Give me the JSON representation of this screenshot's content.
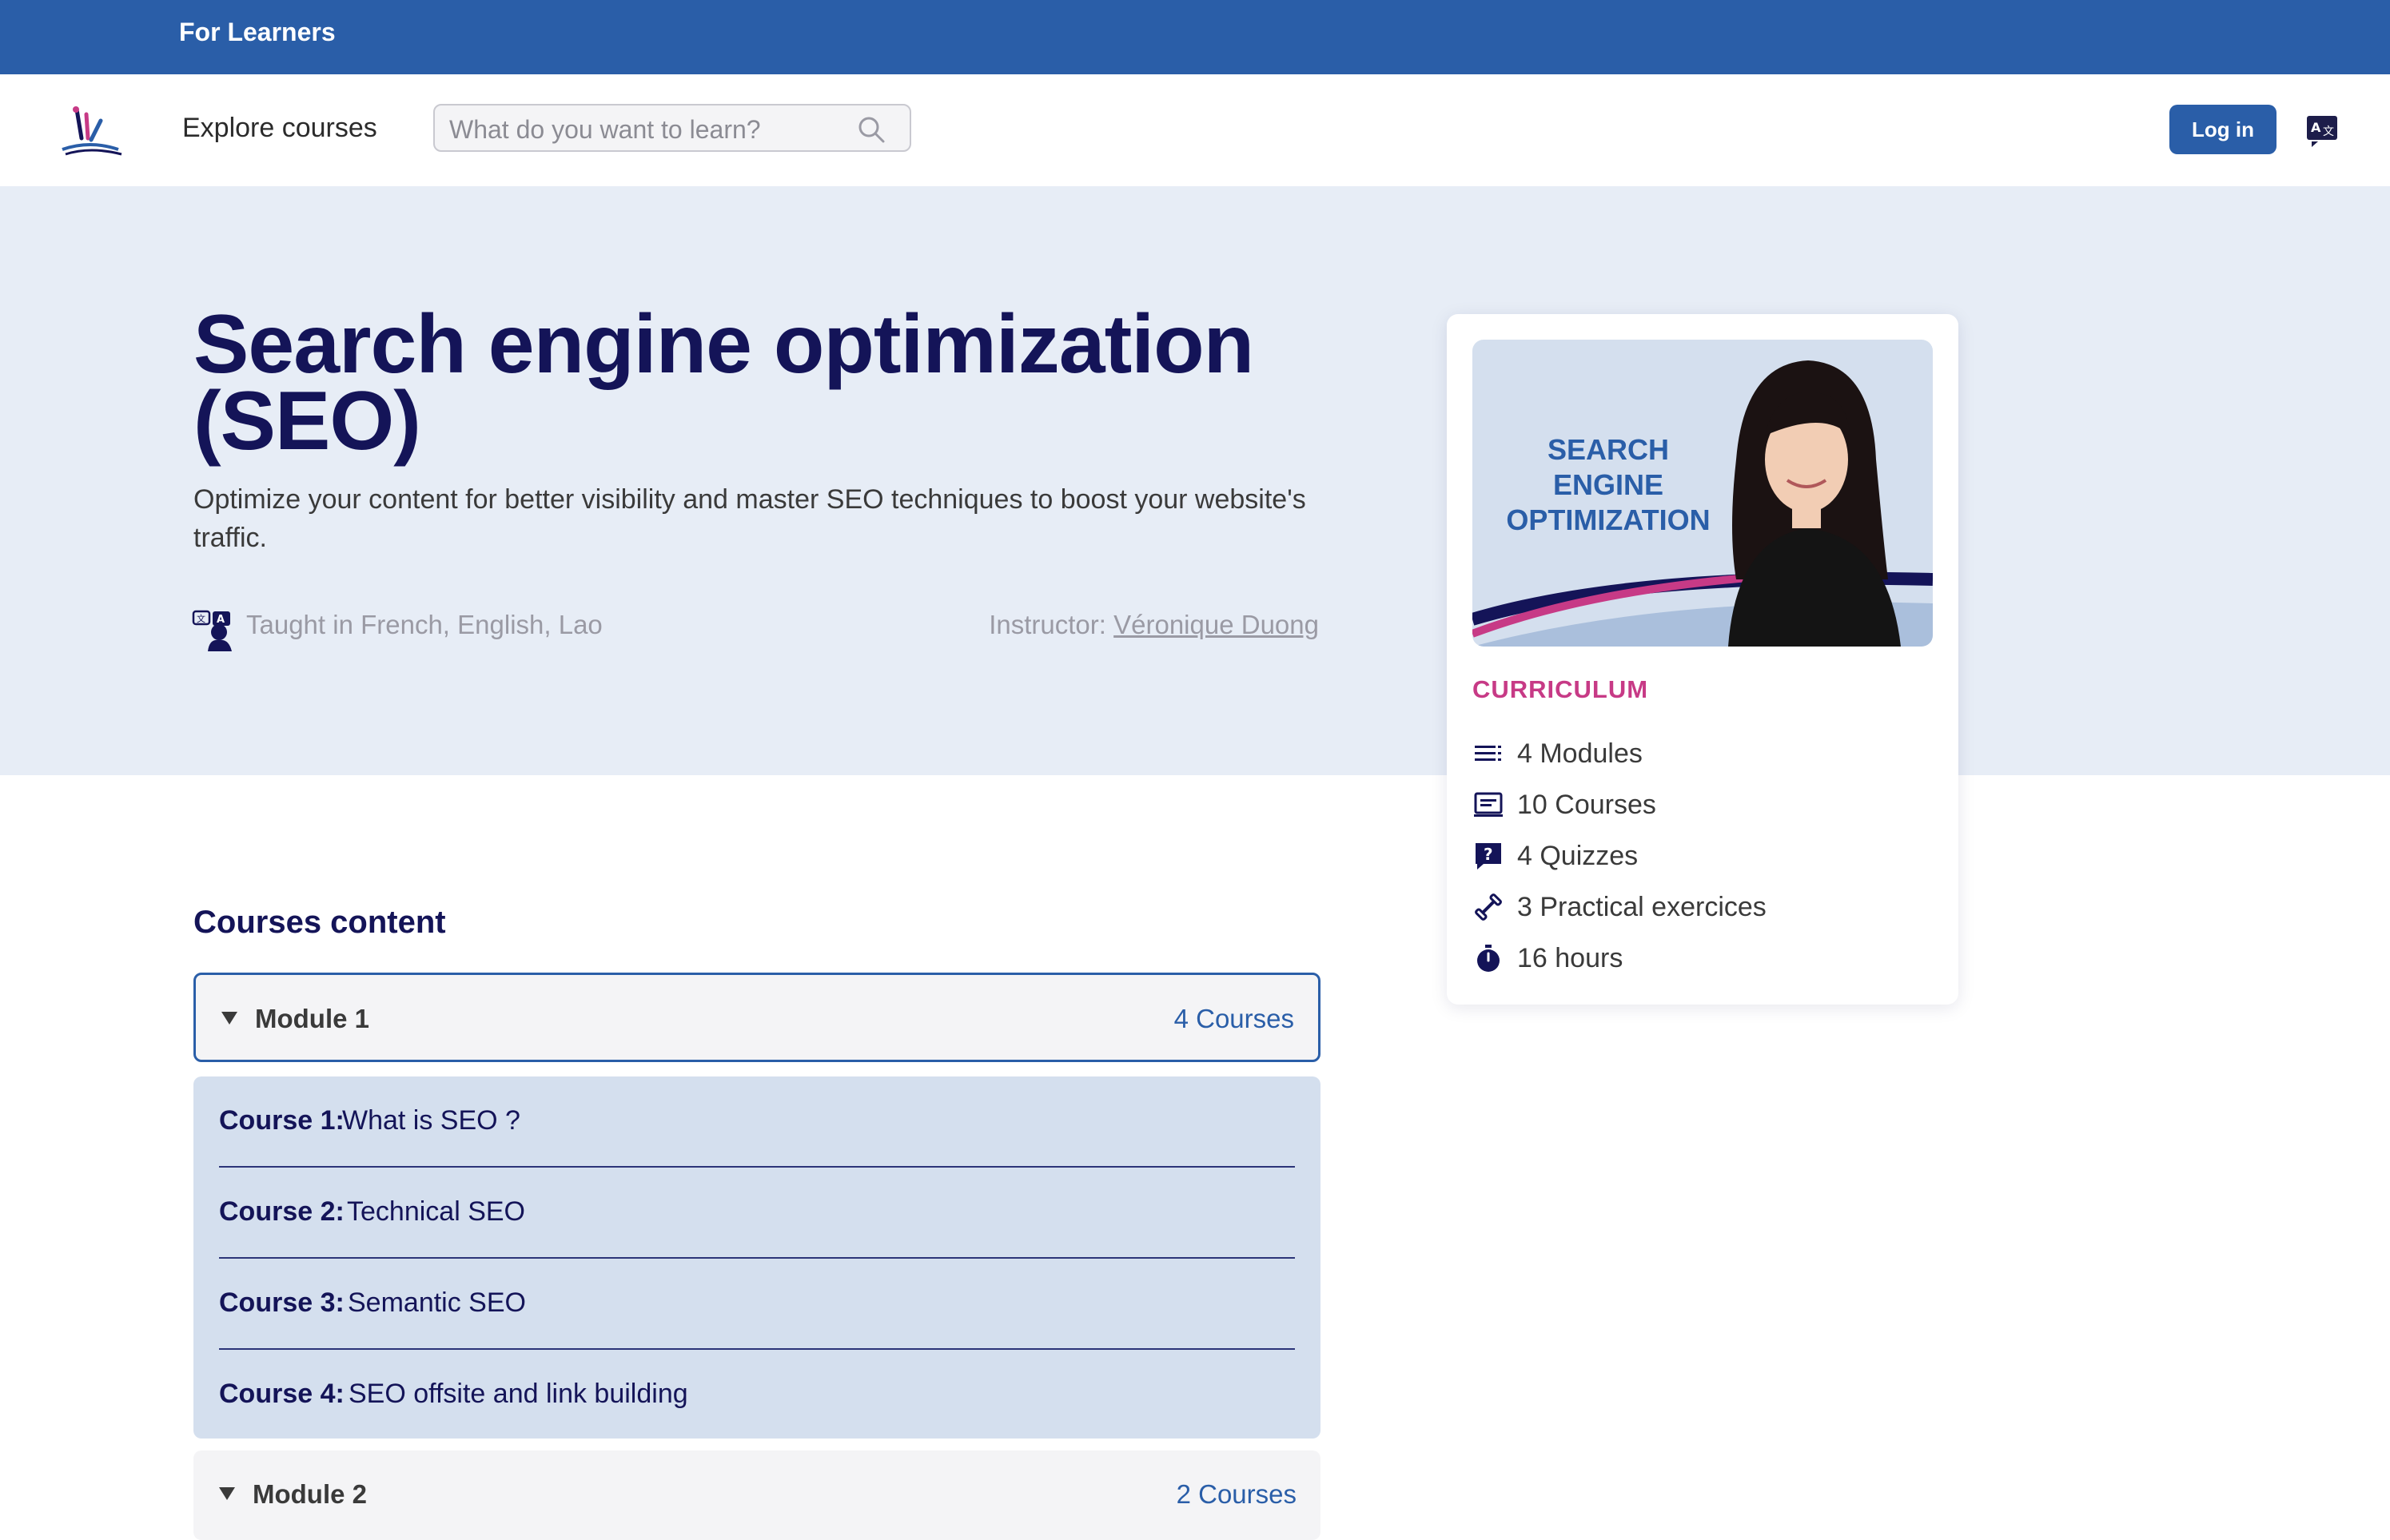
{
  "topbar": {
    "label": "For Learners"
  },
  "nav": {
    "explore_label": "Explore courses",
    "search_placeholder": "What do you want to learn?",
    "login_label": "Log in"
  },
  "hero": {
    "title": "Search engine optimization (SEO)",
    "subtitle": "Optimize your content for better visibility and master SEO techniques to boost your website's traffic.",
    "taught_in": "Taught in French, English, Lao",
    "instructor_label": "Instructor:",
    "instructor_name": "Véronique Duong"
  },
  "card": {
    "image_text_line1": "SEARCH ENGINE",
    "image_text_line2": "OPTIMIZATION",
    "curriculum_heading": "CURRICULUM",
    "items": [
      {
        "icon": "list-icon",
        "text": "4 Modules"
      },
      {
        "icon": "laptop-icon",
        "text": "10 Courses"
      },
      {
        "icon": "quiz-icon",
        "text": "4 Quizzes"
      },
      {
        "icon": "dumbbell-icon",
        "text": "3 Practical exercices"
      },
      {
        "icon": "stopwatch-icon",
        "text": "16 hours"
      }
    ]
  },
  "content": {
    "title": "Courses content",
    "modules": [
      {
        "title": "Module 1",
        "count": "4 Courses",
        "expanded": true,
        "courses": [
          {
            "num": "Course 1:",
            "name": "What is SEO ?"
          },
          {
            "num": "Course 2:",
            "name": "Technical SEO"
          },
          {
            "num": "Course 3:",
            "name": "Semantic SEO"
          },
          {
            "num": "Course 4:",
            "name": "SEO offsite and link building"
          }
        ]
      },
      {
        "title": "Module 2",
        "count": "2 Courses",
        "expanded": false
      }
    ]
  },
  "colors": {
    "brand_blue": "#2a5ea8",
    "navy": "#141458",
    "pink_accent": "#c73a86",
    "hero_bg": "#e7edf6",
    "course_bg": "#d4dfee"
  }
}
